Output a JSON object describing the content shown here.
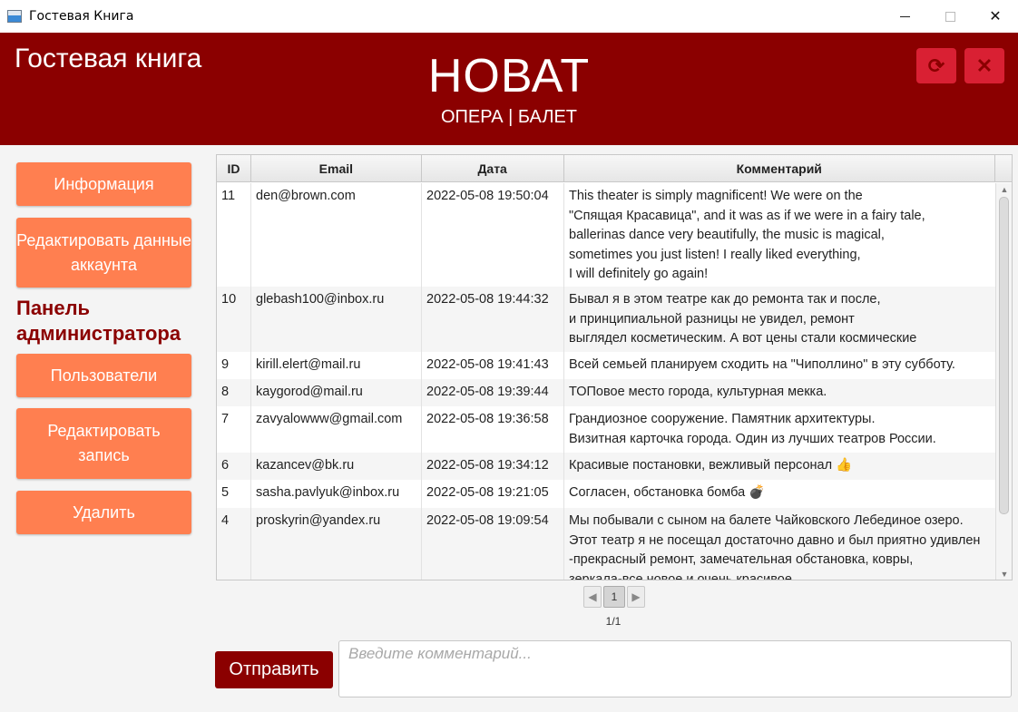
{
  "window": {
    "title": "Гостевая Книга"
  },
  "header": {
    "guestbook_title": "Гостевая книга",
    "brand": "НОВАТ",
    "subtitle": "ОПЕРА | БАЛЕТ",
    "refresh_icon": "refresh-icon",
    "close_icon": "close-icon",
    "refresh_glyph": "⟳",
    "close_glyph": "✕"
  },
  "sidebar": {
    "info_button": "Информация",
    "edit_account_button": "Редактировать данные аккаунта",
    "admin_panel_label": "Панель администратора",
    "users_button": "Пользователи",
    "edit_record_button": "Редактировать запись",
    "delete_button": "Удалить"
  },
  "table": {
    "columns": [
      "ID",
      "Email",
      "Дата",
      "Комментарий"
    ],
    "rows": [
      {
        "id": "11",
        "email": "den@brown.com",
        "date": "2022-05-08 19:50:04",
        "comment": "This theater is simply magnificent! We were on the\n\"Спящая Красавица\", and it was as if we were in a fairy tale,\nballerinas dance very beautifully, the music is magical,\nsometimes you just listen! I really liked everything,\nI will definitely go again!"
      },
      {
        "id": "10",
        "email": "glebash100@inbox.ru",
        "date": "2022-05-08 19:44:32",
        "comment": "Бывал я в этом театре как до ремонта так и после,\nи принципиальной разницы не увидел, ремонт\nвыглядел косметическим. А вот цены стали космические"
      },
      {
        "id": "9",
        "email": "kirill.elert@mail.ru",
        "date": "2022-05-08 19:41:43",
        "comment": "Всей семьей планируем сходить на \"Чиполлино\" в эту субботу."
      },
      {
        "id": "8",
        "email": "kaygorod@mail.ru",
        "date": "2022-05-08 19:39:44",
        "comment": "ТОПовое место города, культурная мекка."
      },
      {
        "id": "7",
        "email": "zavyalowww@gmail.com",
        "date": "2022-05-08 19:36:58",
        "comment": "Грандиозное сооружение. Памятник архитектуры.\nВизитная карточка города. Один из лучших театров России."
      },
      {
        "id": "6",
        "email": "kazancev@bk.ru",
        "date": "2022-05-08 19:34:12",
        "comment": "Красивые постановки, вежливый персонал 👍"
      },
      {
        "id": "5",
        "email": "sasha.pavlyuk@inbox.ru",
        "date": "2022-05-08 19:21:05",
        "comment": "Согласен, обстановка бомба 💣"
      },
      {
        "id": "4",
        "email": "proskyrin@yandex.ru",
        "date": "2022-05-08 19:09:54",
        "comment": "Мы побывали с сыном на балете Чайковского Лебединое озеро.\nЭтот театр я не посещал достаточно давно и был приятно удивлен\n-прекрасный ремонт, замечательная обстановка, ковры,\nзеркала-все новое и очень красивое"
      }
    ]
  },
  "pagination": {
    "current_page": "1",
    "page_info": "1/1",
    "prev_glyph": "◀",
    "next_glyph": "▶"
  },
  "composer": {
    "send_button": "Отправить",
    "placeholder": "Введите комментарий..."
  },
  "colors": {
    "header_bg": "#8b0000",
    "sidebar_button": "#ff7f50",
    "header_button": "#d92033"
  }
}
